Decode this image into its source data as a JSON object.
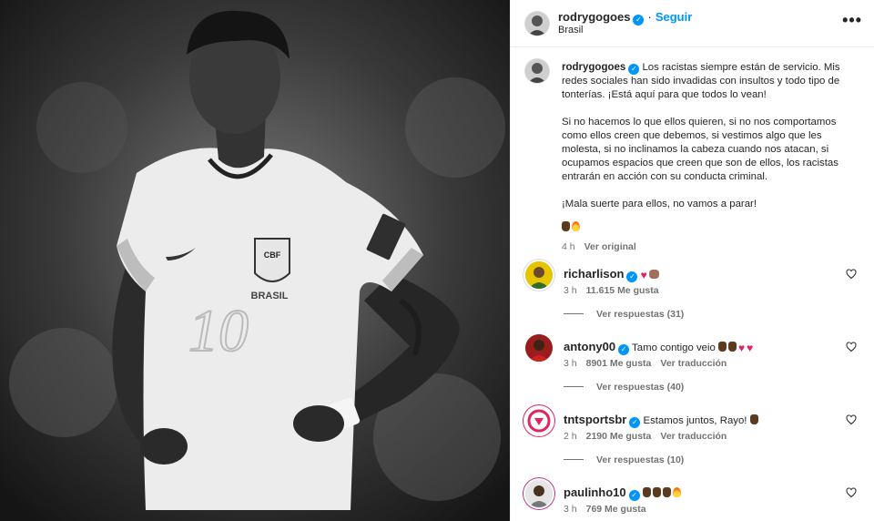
{
  "post": {
    "username": "rodrygogoes",
    "follow_label": "Seguir",
    "location": "Brasil",
    "more_icon": "more-horizontal-icon",
    "image": {
      "shirt_text": "BRASIL",
      "crest_text": "CBF",
      "shirt_number": "10"
    }
  },
  "caption": {
    "username": "rodrygogoes",
    "para1": "Los racistas siempre están de servicio. Mis redes sociales han sido invadidas con insultos y todo tipo de tonterías. ¡Está aquí para que todos lo vean!",
    "para2": "Si no hacemos lo que ellos quieren, si no nos comportamos como ellos creen que debemos, si vestimos algo que les molesta, si no inclinamos la cabeza cuando nos atacan, si ocupamos espacios que creen que son de ellos, los racistas entrarán en acción con su conducta criminal.",
    "para3": "¡Mala suerte para ellos, no vamos a parar!",
    "time": "4 h",
    "see_original": "Ver original"
  },
  "comments": [
    {
      "username": "richarlison",
      "text": "",
      "time": "3 h",
      "likes": "11.615 Me gusta",
      "action": "",
      "replies": "Ver respuestas (31)"
    },
    {
      "username": "antony00",
      "text": "Tamo contigo veio",
      "time": "3 h",
      "likes": "8901 Me gusta",
      "action": "Ver traducción",
      "replies": "Ver respuestas (40)"
    },
    {
      "username": "tntsportsbr",
      "text": "Estamos juntos, Rayo!",
      "time": "2 h",
      "likes": "2190 Me gusta",
      "action": "Ver traducción",
      "replies": "Ver respuestas (10)"
    },
    {
      "username": "paulinho10",
      "text": "",
      "time": "3 h",
      "likes": "769 Me gusta",
      "action": "",
      "replies": ""
    }
  ],
  "colors": {
    "accent": "#0095f6",
    "text": "#262626",
    "muted": "#737373",
    "heart": "#e0245e"
  }
}
